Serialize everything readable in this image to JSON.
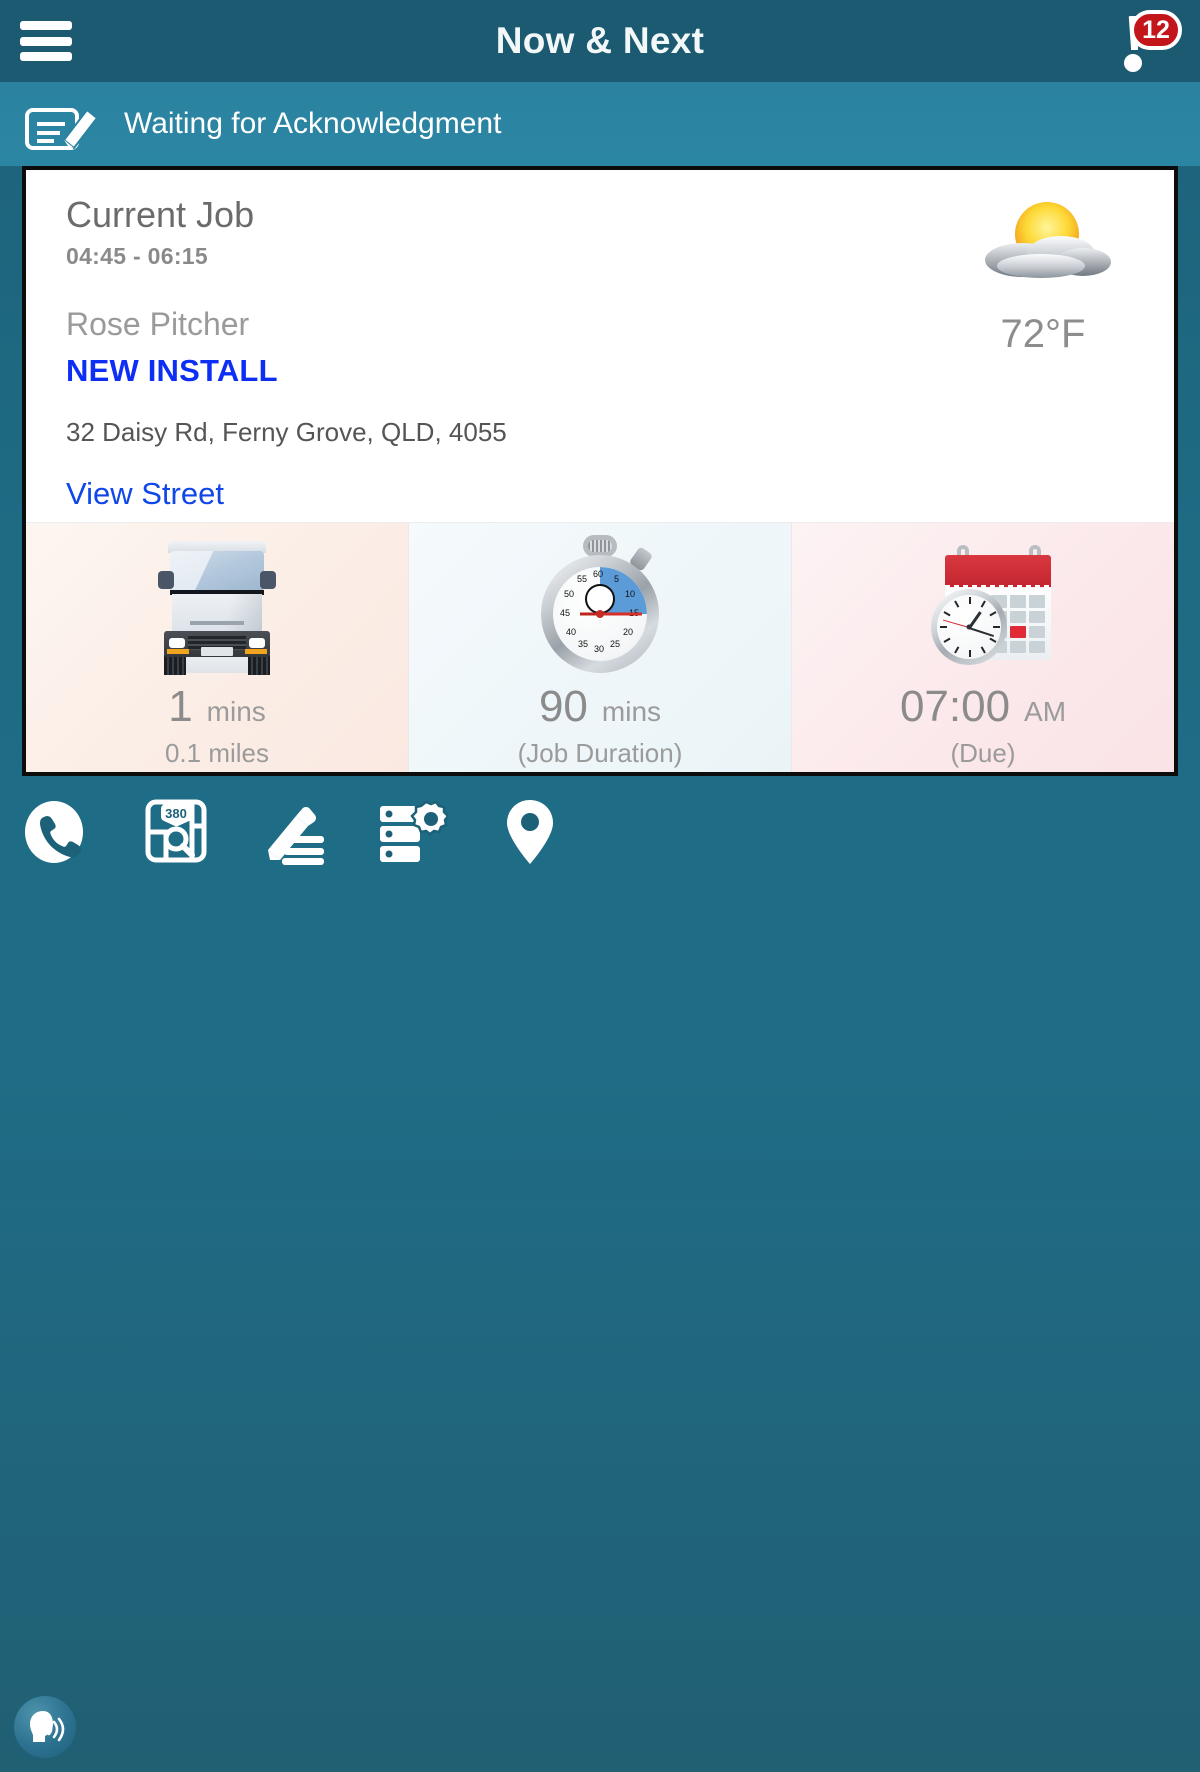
{
  "header": {
    "title": "Now & Next",
    "menu_icon": "hamburger-menu-icon",
    "notification_icon": "alert-exclamation-icon",
    "notification_count": "12"
  },
  "status": {
    "icon": "signature-pen-icon",
    "text": "Waiting for Acknowledgment"
  },
  "job": {
    "heading": "Current Job",
    "time_window": "04:45 - 06:15",
    "customer": "Rose Pitcher",
    "job_type": "NEW INSTALL",
    "address": "32 Daisy Rd, Ferny Grove, QLD, 4055",
    "view_street_link": "View Street",
    "weather": {
      "icon": "sun-behind-cloud-icon",
      "temperature": "72°F"
    },
    "metrics": [
      {
        "icon": "delivery-van-icon",
        "value": "1",
        "unit": "mins",
        "sub": "0.1 miles",
        "name": "travel-time"
      },
      {
        "icon": "stopwatch-icon",
        "value": "90",
        "unit": "mins",
        "sub": "(Job Duration)",
        "name": "job-duration"
      },
      {
        "icon": "calendar-clock-icon",
        "value": "07:00",
        "unit": "AM",
        "sub": "(Due)",
        "name": "due-time"
      }
    ]
  },
  "actions": [
    {
      "name": "call-button",
      "icon": "phone-icon"
    },
    {
      "name": "map-button",
      "icon": "map-search-icon",
      "label": "380"
    },
    {
      "name": "notes-button",
      "icon": "pencil-notes-icon"
    },
    {
      "name": "equipment-button",
      "icon": "server-gear-icon"
    },
    {
      "name": "location-button",
      "icon": "location-pin-icon"
    }
  ],
  "voice_assistant": {
    "name": "voice-assistant-button",
    "icon": "speaking-head-icon"
  },
  "colors": {
    "background": "#1e6b84",
    "header": "#1b5a70",
    "status_strip": "#2a82a0",
    "accent_blue": "#0d2ff5",
    "link_blue": "#1047e8",
    "badge_red": "#c2161b"
  }
}
